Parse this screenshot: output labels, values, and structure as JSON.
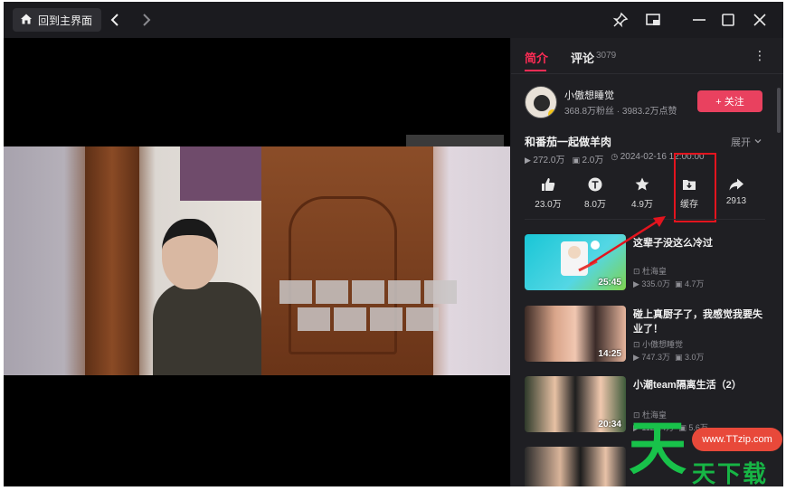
{
  "titlebar": {
    "home_label": "回到主界面",
    "icons": [
      "home-icon",
      "back-icon",
      "forward-icon",
      "pin-icon",
      "pip-icon",
      "minimize-icon",
      "maximize-icon",
      "close-icon"
    ]
  },
  "panel": {
    "tab_intro": "简介",
    "tab_comments": "评论",
    "comment_count": "3079",
    "more_icon": "⋮",
    "author_name": "小傲想睡觉",
    "author_stats": "368.8万粉丝 · 3983.2万点赞",
    "follow_label": "+ 关注",
    "video_title": "和番茄一起做羊肉",
    "expand_label": "展开",
    "meta": {
      "plays": "272.0万",
      "comments": "2.0万",
      "date": "2024-02-16 12:00:00"
    },
    "actions": [
      {
        "icon": "thumbs-up-icon",
        "label": "23.0万"
      },
      {
        "icon": "coin-icon",
        "label": "8.0万"
      },
      {
        "icon": "star-icon",
        "label": "4.9万"
      },
      {
        "icon": "cache-download-icon",
        "label": "缓存"
      },
      {
        "icon": "share-icon",
        "label": "2913"
      }
    ],
    "recommendations": [
      {
        "title": "这辈子没这么冷过",
        "author": "杜海皇",
        "plays": "335.0万",
        "comments": "4.7万",
        "duration": "25:45"
      },
      {
        "title": "碰上真厨子了，我感觉我要失业了！",
        "author": "小傲想睡觉",
        "plays": "747.3万",
        "comments": "3.0万",
        "duration": "14:25"
      },
      {
        "title": "小潮team隔离生活（2）",
        "author": "杜海皇",
        "plays": "1121.4万",
        "comments": "5.6万",
        "duration": "20:34"
      },
      {
        "title": "",
        "author": "",
        "plays": "",
        "comments": "",
        "duration": ""
      }
    ]
  },
  "watermark": {
    "big_char": "天",
    "text": "天下载",
    "url": "www.TTzip.com"
  },
  "colors": {
    "accent": "#fe2c55",
    "follow": "#e9415f",
    "highlight": "#e3141e",
    "watermark_green": "#18c24a"
  }
}
